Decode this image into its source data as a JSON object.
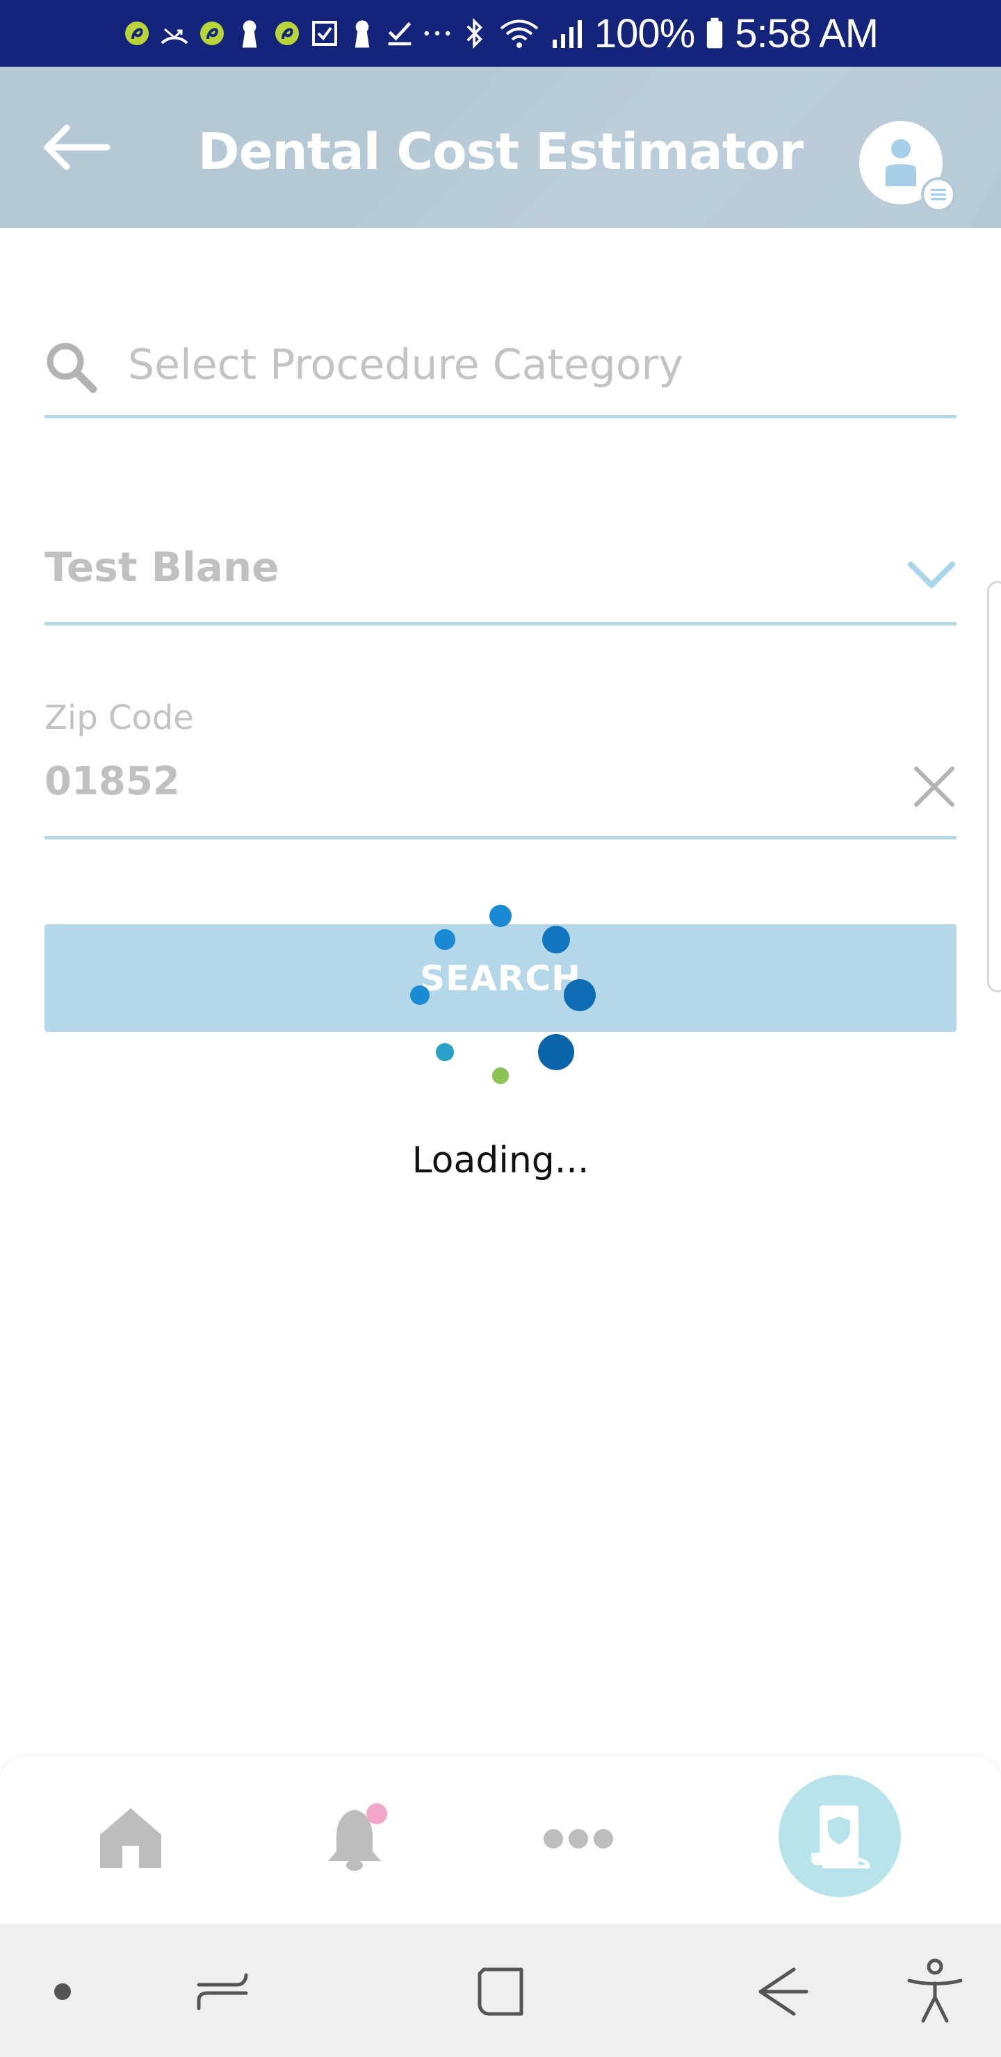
{
  "status_bar": {
    "icons": [
      "app-notification-icon",
      "missed-call-icon",
      "app-notification-icon",
      "keyhole-icon",
      "app-notification-icon",
      "task-checkbox-icon",
      "keyhole-icon",
      "checkmark-icon",
      "more-notifications-icon",
      "bluetooth-icon",
      "wifi-icon",
      "signal-icon"
    ],
    "battery": "100%",
    "time": "5:58 AM"
  },
  "header": {
    "title": "Dental Cost Estimator",
    "color": "#b4c8d6"
  },
  "form": {
    "procedure_search": {
      "placeholder": "Select Procedure Category"
    },
    "member_select": {
      "value": "Test Blane"
    },
    "zip_code": {
      "label": "Zip Code",
      "value": "01852"
    },
    "search_button": {
      "label": "SEARCH",
      "color": "#b4d8ea"
    }
  },
  "loader": {
    "text": "Loading..."
  },
  "bottom_nav": {
    "items": [
      {
        "name": "home-icon"
      },
      {
        "name": "notifications-bell-icon",
        "badge_color": "#f4a6c8"
      },
      {
        "name": "more-icon"
      },
      {
        "name": "dental-policy-icon",
        "active": true
      }
    ]
  },
  "system_nav": {
    "items": [
      "dot-icon",
      "recents-icon",
      "home-square-icon",
      "back-arrow-icon",
      "accessibility-icon"
    ]
  },
  "colors": {
    "status_bar": "#13247a",
    "underline": "#b8d7e6",
    "spinner_blue": "#1a8ad4",
    "spinner_dark": "#0b63a8",
    "spinner_green": "#8cc153"
  }
}
